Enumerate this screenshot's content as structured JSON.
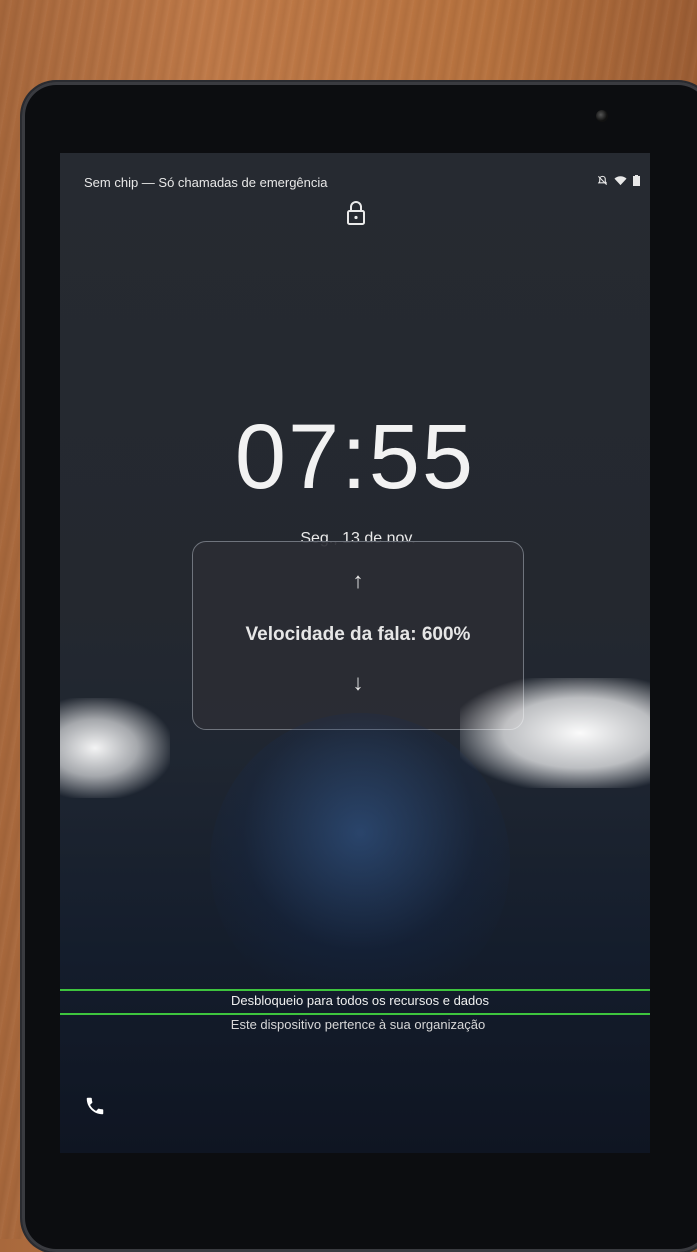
{
  "status_bar": {
    "carrier_text": "Sem chip — Só chamadas de emergência",
    "icons": [
      "notifications-off-icon",
      "wifi-icon",
      "battery-icon"
    ]
  },
  "lock_screen": {
    "time": "07:55",
    "date": "Seg., 13 de nov."
  },
  "speech_overlay": {
    "label": "Velocidade da fala: 600%",
    "up_arrow": "↑",
    "down_arrow": "↓"
  },
  "footer": {
    "unlock_text": "Desbloqueio para todos os recursos e dados",
    "org_text": "Este dispositivo pertence à sua organização"
  },
  "colors": {
    "focus_outline": "#3ec43e"
  }
}
